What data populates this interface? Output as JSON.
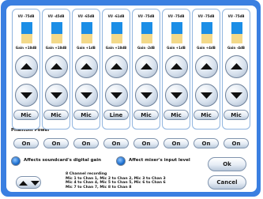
{
  "channels": [
    {
      "vu": "VU -75dB",
      "gain": "Gain +18dB",
      "level": 0.55,
      "input": "Mic",
      "phantom": "On"
    },
    {
      "vu": "VU -45dB",
      "gain": "Gain +18dB",
      "level": 0.55,
      "input": "Mic",
      "phantom": "On"
    },
    {
      "vu": "VU -65dB",
      "gain": "Gain +1dB",
      "level": 0.55,
      "input": "Mic",
      "phantom": "On"
    },
    {
      "vu": "VU -61dB",
      "gain": "Gain +18dB",
      "level": 0.55,
      "input": "Line",
      "phantom": "On"
    },
    {
      "vu": "VU -75dB",
      "gain": "Gain -2dB",
      "level": 0.55,
      "input": "Mic",
      "phantom": "On"
    },
    {
      "vu": "VU -75dB",
      "gain": "Gain +1dB",
      "level": 0.55,
      "input": "Mic",
      "phantom": "On"
    },
    {
      "vu": "VU -75dB",
      "gain": "Gain +4dB",
      "level": 0.55,
      "input": "Mic",
      "phantom": "On"
    },
    {
      "vu": "VU -75dB",
      "gain": "Gain -4dB",
      "level": 0.55,
      "input": "Mic",
      "phantom": "On"
    }
  ],
  "phantom_power_label": "Phantom Power",
  "options": {
    "digital_gain": "Affects soundcard's digital gain",
    "input_level": "Affect mixer's input level"
  },
  "mapping": {
    "title": "8 Channel recording",
    "lines": [
      "Mic 1 to Chan 1, Mic 2 to Chan 2, Mic 3 to Chan 3",
      "Mic 4 to Chan 4, Mic 5 to Chan 5, Mic 6 to Chan 6",
      "Mic 7 to Chan 7, Mic 8 to Chan 8"
    ]
  },
  "buttons": {
    "ok": "Ok",
    "cancel": "Cancel"
  },
  "colors": {
    "accent": "#3a7fe1",
    "meter_fill": "#1b8ee6",
    "meter_bg": "#f3d98a"
  }
}
